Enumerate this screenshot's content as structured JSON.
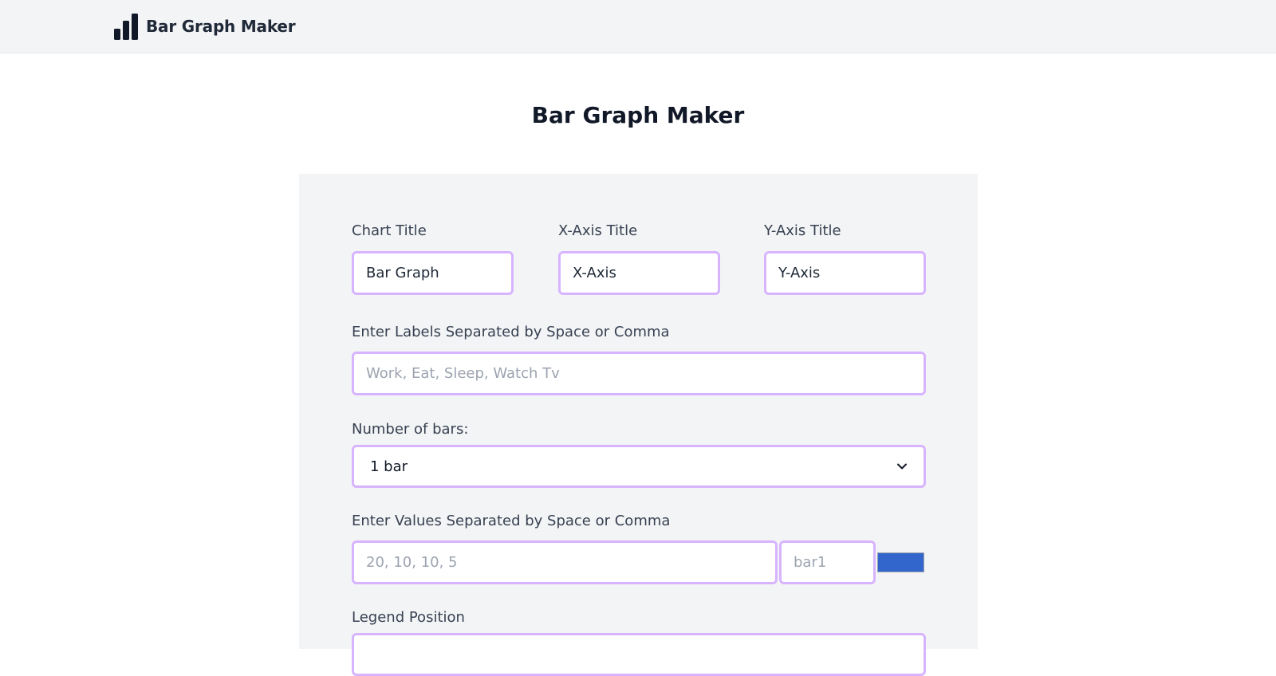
{
  "navbar": {
    "brand_name": "Bar Graph Maker",
    "brand_icon": "bar-chart-icon"
  },
  "page": {
    "title": "Bar Graph Maker"
  },
  "form": {
    "chart_title": {
      "label": "Chart Title",
      "value": "Bar Graph"
    },
    "x_axis_title": {
      "label": "X-Axis Title",
      "value": "X-Axis"
    },
    "y_axis_title": {
      "label": "Y-Axis Title",
      "value": "Y-Axis"
    },
    "labels": {
      "label": "Enter Labels Separated by Space or Comma",
      "placeholder": "Work, Eat, Sleep, Watch Tv"
    },
    "number_of_bars": {
      "label": "Number of bars:",
      "selected": "1 bar",
      "icon": "chevron-down-icon"
    },
    "values": {
      "label": "Enter Values Separated by Space or Comma",
      "placeholder": "20, 10, 10, 5",
      "series_name_placeholder": "bar1",
      "series_color": "#3366cc"
    },
    "legend_position": {
      "label": "Legend Position"
    }
  },
  "colors": {
    "accent_border": "#d8b4fe",
    "panel_bg": "#f3f4f6",
    "navbar_bg": "#f3f4f6"
  }
}
